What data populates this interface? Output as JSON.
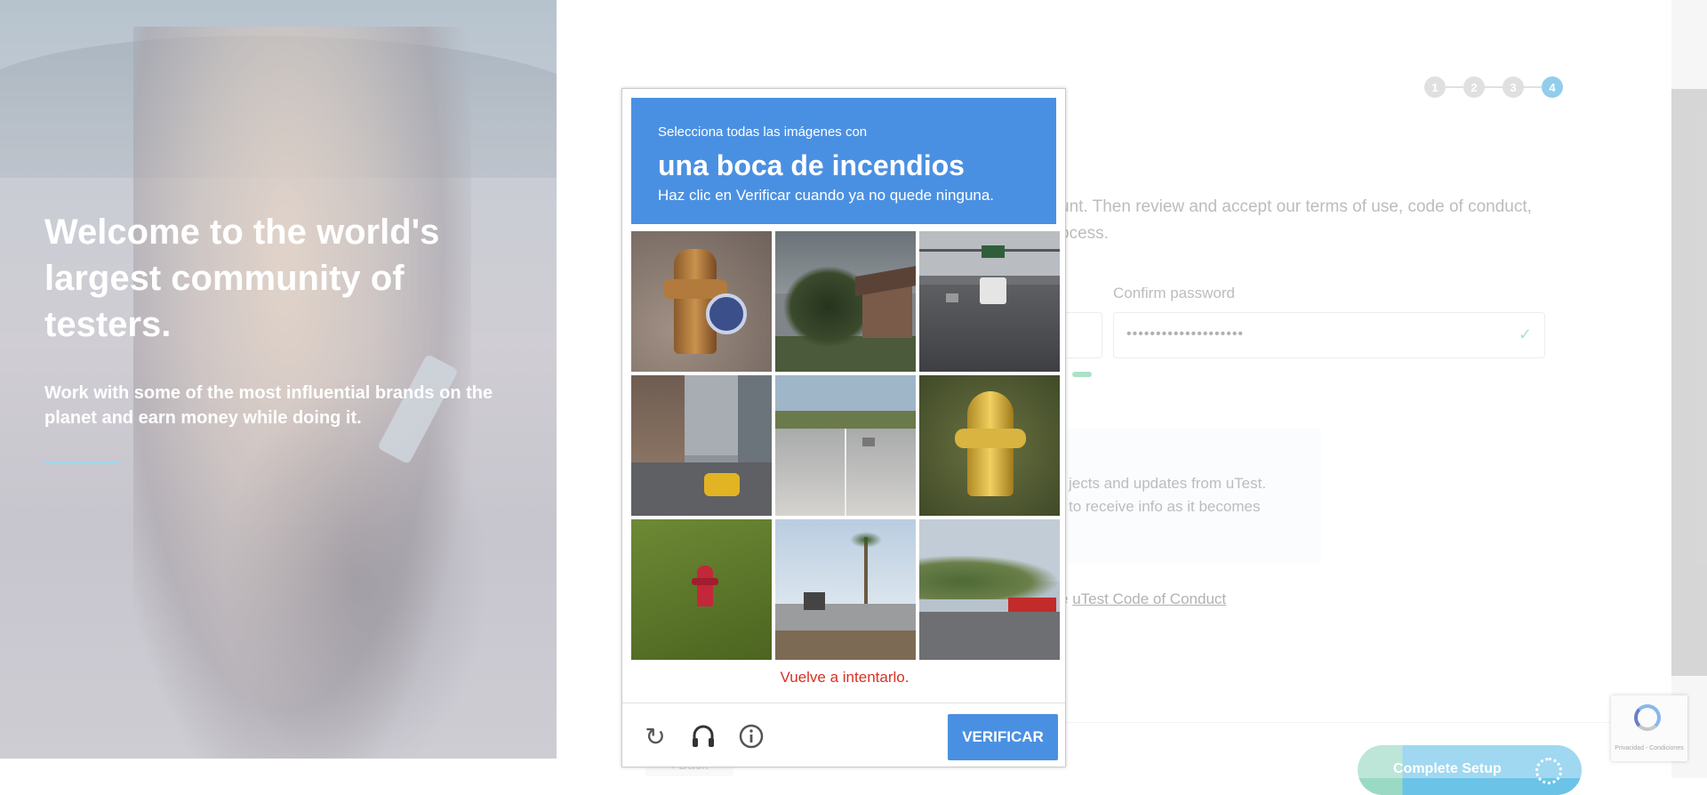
{
  "hero": {
    "title": "Welcome to the world's largest community of testers.",
    "subtitle": "Work with some of the most influential brands on the planet and earn money while doing it."
  },
  "steps": [
    "1",
    "2",
    "3",
    "4"
  ],
  "active_step": "4",
  "form": {
    "intro_line1": "unt. Then review and accept our terms of use, code of conduct,",
    "intro_line2": "ocess.",
    "confirm_password_label": "Confirm password",
    "confirm_password_value": "••••••••••••••••••••",
    "info_line1": "jects and updates from uTest.",
    "info_line2": "to receive info as it becomes",
    "coc_prefix": "e ",
    "coc_link": "uTest Code of Conduct",
    "back_label": "Back",
    "complete_label": "Complete Setup"
  },
  "captcha": {
    "instruction_small": "Selecciona todas las imágenes con",
    "target": "una boca de incendios",
    "instruction_hint": "Haz clic en Verificar cuando ya no quede ninguna.",
    "error": "Vuelve a intentarlo.",
    "verify_label": "VERIFICAR",
    "tiles": [
      "fire-hydrant-close-up",
      "palm-tree-house",
      "highway-traffic-sign",
      "city-street-taxi",
      "empty-highway",
      "yellow-fire-hydrant",
      "red-hydrant-grass",
      "palm-trees-roof",
      "gas-station-street"
    ]
  },
  "recaptcha_badge": {
    "text": "Privacidad - Condiciones"
  },
  "colors": {
    "captcha_blue": "#4a90e2",
    "active_step": "#5ab2e2",
    "error_red": "#d93025"
  }
}
